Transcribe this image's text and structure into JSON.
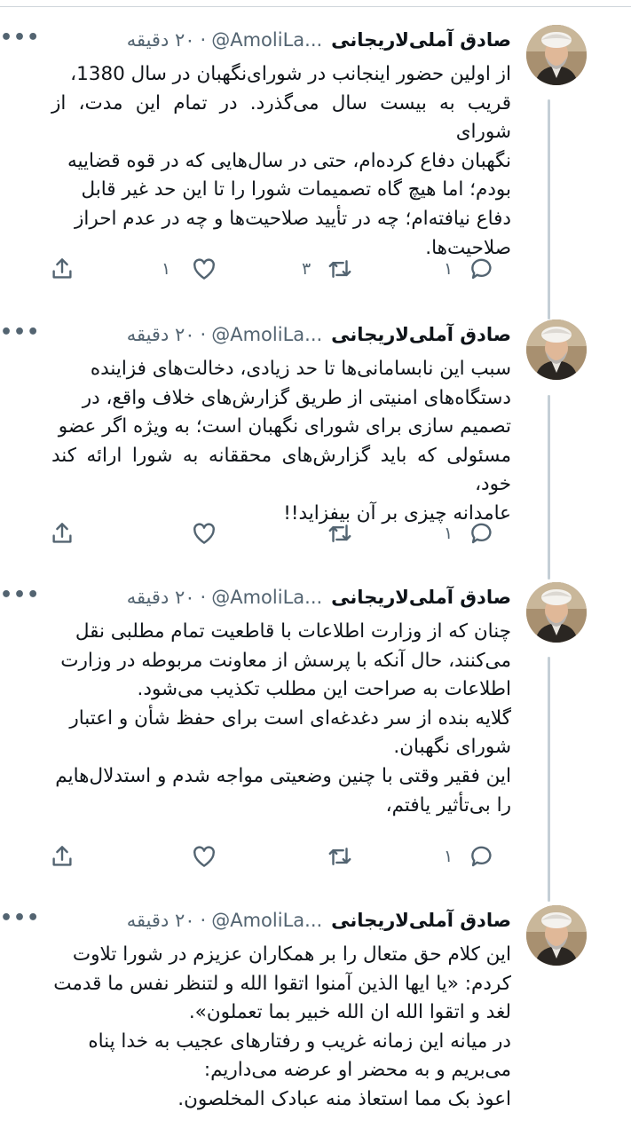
{
  "colors": {
    "text": "#0f1419",
    "secondary": "#536471",
    "thread_line": "#c4cfd6"
  },
  "tweets": [
    {
      "author": "صادق آملی‌لاریجانی",
      "handle": "@AmoliLa...",
      "dot": "·",
      "time": "۲۰ دقیقه",
      "more": "•••",
      "lines": [
        "از اولین حضور اینجانب در شورای‌نگهبان در سال 1380،",
        "قریب به بیست سال می‌گذرد. در تمام این مدت، از شورای",
        "نگهبان دفاع کرده‌ام، حتی در سال‌هایی که در قوه قضاییه",
        "بودم؛ اما هیچ گاه تصمیمات شورا را تا این حد غیر قابل",
        "دفاع نیافته‌ام؛ چه در تأیید صلاحیت‌ها و چه در عدم احراز",
        "صلاحیت‌ها."
      ],
      "replies": "۱",
      "retweets": "۳",
      "likes": "۱"
    },
    {
      "author": "صادق آملی‌لاریجانی",
      "handle": "@AmoliLa...",
      "dot": "·",
      "time": "۲۰ دقیقه",
      "more": "•••",
      "lines": [
        "سبب این نابسامانی‌ها تا حد زیادی، دخالت‌های فزاینده",
        "دستگاه‌های امنیتی از طریق گزارش‌های خلاف واقع، در",
        "تصمیم سازی برای شورای نگهبان است؛ به ویژه اگر عضو",
        "مسئولی که باید گزارش‌های محققانه به شورا ارائه کند خود،",
        "عامدانه چیزی بر آن بیفزاید!!"
      ],
      "replies": "۱",
      "retweets": "",
      "likes": ""
    },
    {
      "author": "صادق آملی‌لاریجانی",
      "handle": "@AmoliLa...",
      "dot": "·",
      "time": "۲۰ دقیقه",
      "more": "•••",
      "lines": [
        "چنان که از وزارت اطلاعات با قاطعیت تمام مطلبی نقل",
        "می‌کنند، حال آنکه با پرسش از معاونت مربوطه در وزارت",
        "اطلاعات به صراحت این مطلب تکذیب می‌شود.",
        "گلایه بنده از سر دغدغه‌ای است برای حفظ شأن و اعتبار",
        "شورای نگهبان.",
        "این فقیر وقتی با چنین وضعیتی مواجه شدم و استدلال‌هایم",
        "را بی‌تأثیر یافتم،"
      ],
      "replies": "۱",
      "retweets": "",
      "likes": ""
    },
    {
      "author": "صادق آملی‌لاریجانی",
      "handle": "@AmoliLa...",
      "dot": "·",
      "time": "۲۰ دقیقه",
      "more": "•••",
      "lines": [
        "این کلام حق متعال را بر همکاران عزیزم در شورا تلاوت",
        "کردم: «یا ایها الذین آمنوا اتقوا الله و لتنظر نفس ما قدمت",
        "لغد و اتقوا الله ان الله خبیر بما تعملون».",
        "در میانه این زمانه غریب و رفتارهای عجیب به خدا پناه",
        "می‌بریم و به محضر او عرضه می‌داریم:",
        "اعوذ بک مما استعاذ منه عبادک المخلصون."
      ]
    }
  ]
}
